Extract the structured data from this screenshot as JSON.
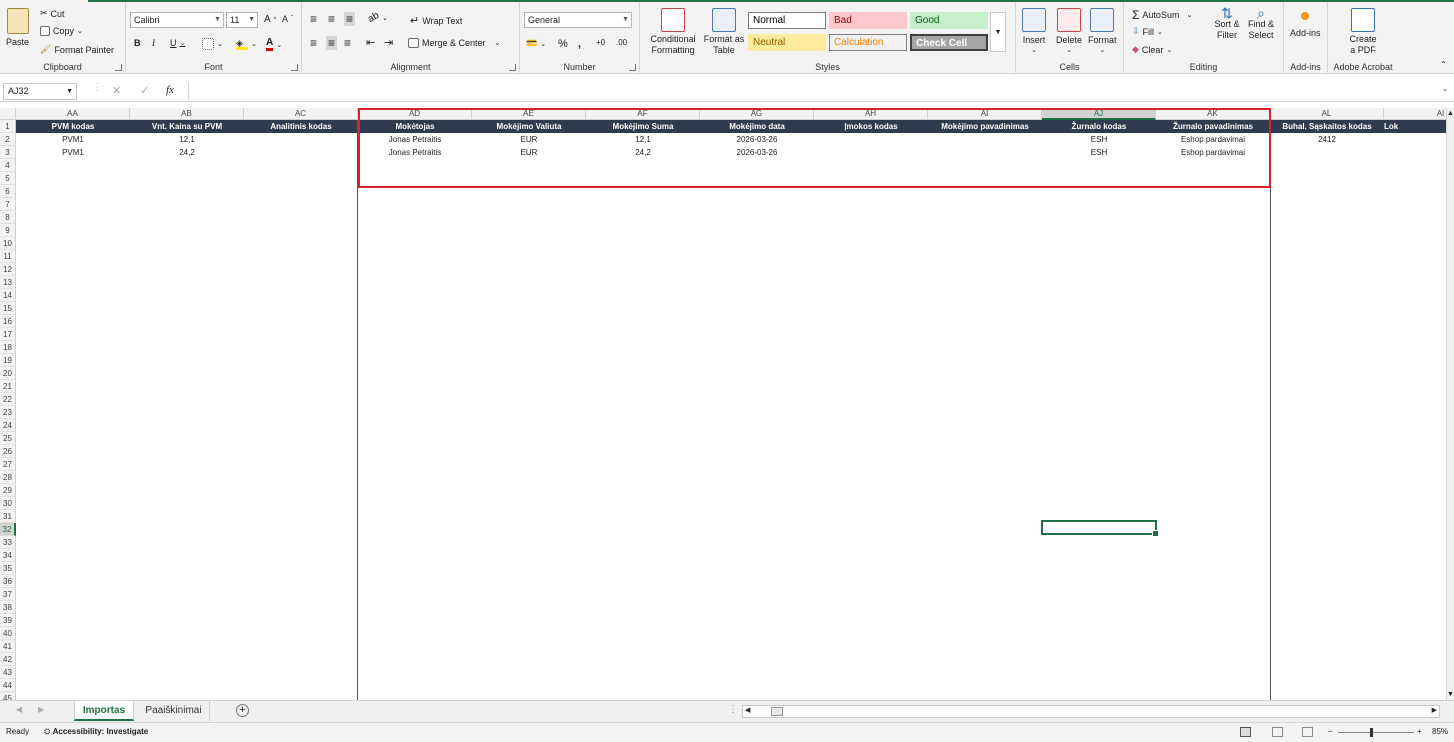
{
  "ribbon": {
    "clipboard": {
      "paste": "Paste",
      "cut": "Cut",
      "copy": "Copy",
      "format_painter": "Format Painter",
      "label": "Clipboard"
    },
    "font": {
      "name": "Calibri",
      "size": "11",
      "bold": "B",
      "italic": "I",
      "underline": "U",
      "label": "Font"
    },
    "alignment": {
      "wrap_text": "Wrap Text",
      "merge_center": "Merge & Center",
      "label": "Alignment"
    },
    "number": {
      "format": "General",
      "percent": "%",
      "comma": ",",
      "label": "Number"
    },
    "styles": {
      "conditional": "Conditional Formatting",
      "format_table": "Format as Table",
      "normal": "Normal",
      "bad": "Bad",
      "good": "Good",
      "neutral": "Neutral",
      "calculation": "Calculation",
      "check_cell": "Check Cell",
      "label": "Styles"
    },
    "cells": {
      "insert": "Insert",
      "delete": "Delete",
      "format": "Format",
      "label": "Cells"
    },
    "editing": {
      "autosum": "AutoSum",
      "fill": "Fill",
      "clear": "Clear",
      "sort_filter": "Sort & Filter",
      "find_select": "Find & Select",
      "label": "Editing"
    },
    "addins": {
      "addins": "Add-ins",
      "label": "Add-ins"
    },
    "acrobat": {
      "create_pdf": "Create a PDF",
      "label": "Adobe Acrobat"
    }
  },
  "formula_bar": {
    "name_box": "AJ32",
    "fx": "fx",
    "value": ""
  },
  "columns": [
    "AA",
    "AB",
    "AC",
    "AD",
    "AE",
    "AF",
    "AG",
    "AH",
    "AI",
    "AJ",
    "AK",
    "AL",
    "AI"
  ],
  "headers": [
    "PVM kodas",
    "Vnt. Kaina su PVM",
    "Analitinis kodas",
    "Mokėtojas",
    "Mokėjimo Valiuta",
    "Mokėjimo Suma",
    "Mokėjimo data",
    "Įmokos kodas",
    "Mokėjimo pavadinimas",
    "Žurnalo kodas",
    "Žurnalo pavadinimas",
    "Buhal. Sąskaitos kodas",
    "Lok"
  ],
  "rows": [
    [
      "PVM1",
      "12,1",
      "",
      "Jonas Petraitis",
      "EUR",
      "12,1",
      "2026-03-26",
      "",
      "",
      "ESH",
      "Eshop pardavimai",
      "2412",
      ""
    ],
    [
      "PVM1",
      "24,2",
      "",
      "Jonas Petraitis",
      "EUR",
      "24,2",
      "2026-03-26",
      "",
      "",
      "ESH",
      "Eshop pardavimai",
      "",
      ""
    ]
  ],
  "row_numbers": [
    "1",
    "2",
    "3",
    "4",
    "5",
    "6",
    "7",
    "8",
    "9",
    "10",
    "11",
    "12",
    "13",
    "14",
    "15",
    "16",
    "17",
    "18",
    "19",
    "20",
    "21",
    "22",
    "23",
    "24",
    "25",
    "26",
    "27",
    "28",
    "29",
    "30",
    "31",
    "32",
    "33",
    "34",
    "35",
    "36",
    "37",
    "38",
    "39",
    "40",
    "41",
    "42",
    "43",
    "44",
    "45"
  ],
  "selected": {
    "column": "AJ",
    "row": "32"
  },
  "sheets": [
    "Importas",
    "Paaiškinimai"
  ],
  "active_sheet": "Importas",
  "status": {
    "ready": "Ready",
    "accessibility": "Accessibility: Investigate",
    "zoom": "85%"
  },
  "colors": {
    "header_bg": "#2f3c4f",
    "accent": "#1e7145",
    "highlight": "#d9232a"
  }
}
